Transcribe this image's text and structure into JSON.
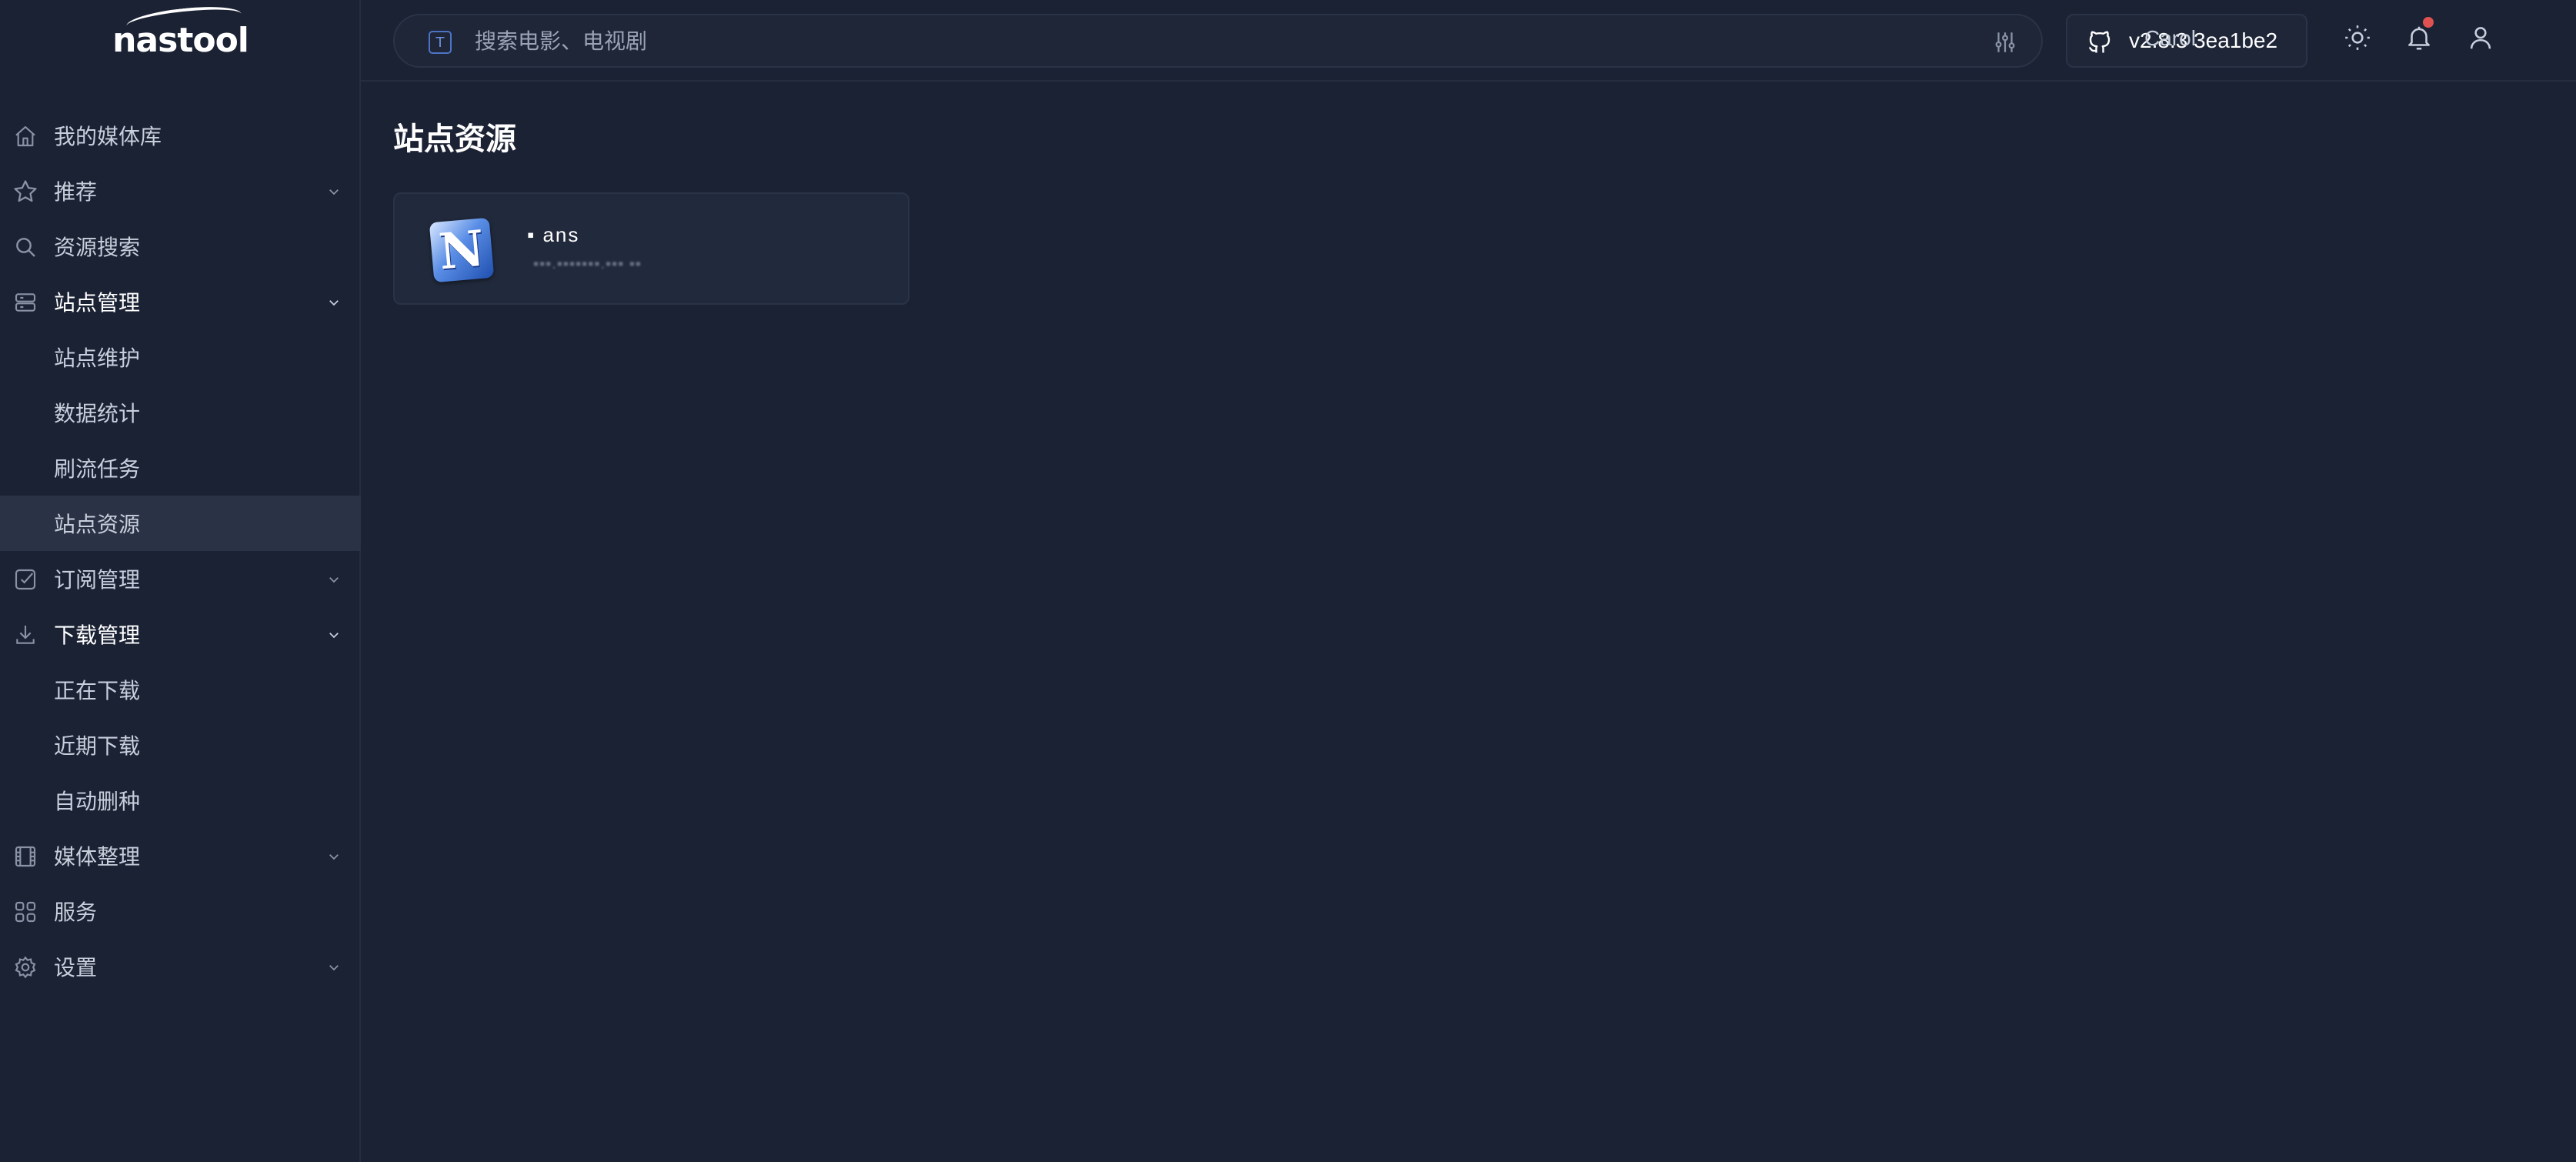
{
  "app": {
    "logo": "nastool"
  },
  "sidebar": {
    "items": [
      {
        "label": "我的媒体库",
        "icon": "home-icon"
      },
      {
        "label": "推荐",
        "icon": "star-icon"
      },
      {
        "label": "资源搜索",
        "icon": "search-icon"
      },
      {
        "label": "站点管理",
        "icon": "server-icon"
      },
      {
        "label": "站点维护"
      },
      {
        "label": "数据统计"
      },
      {
        "label": "刷流任务"
      },
      {
        "label": "站点资源"
      },
      {
        "label": "订阅管理",
        "icon": "checkbox-icon"
      },
      {
        "label": "下载管理",
        "icon": "download-icon"
      },
      {
        "label": "正在下载"
      },
      {
        "label": "近期下载"
      },
      {
        "label": "自动删种"
      },
      {
        "label": "媒体整理",
        "icon": "film-icon"
      },
      {
        "label": "服务",
        "icon": "grid-icon"
      },
      {
        "label": "设置",
        "icon": "gear-icon"
      }
    ]
  },
  "header": {
    "search_placeholder": "搜索电影、电视剧",
    "search_hint": "T",
    "version": "v2.8.3 3ea1be2",
    "user_name": "Carol"
  },
  "main": {
    "title": "站点资源",
    "sites": [
      {
        "name": "▪ ans",
        "url": "▪▪▪.▪▪▪▪▪▪▪.▪▪▪ ▪▪",
        "logo_letter": "N"
      }
    ]
  },
  "colors": {
    "background": "#1b2234",
    "card": "#212a3c",
    "active_item": "#2a3245",
    "notification_dot": "#e05252"
  }
}
